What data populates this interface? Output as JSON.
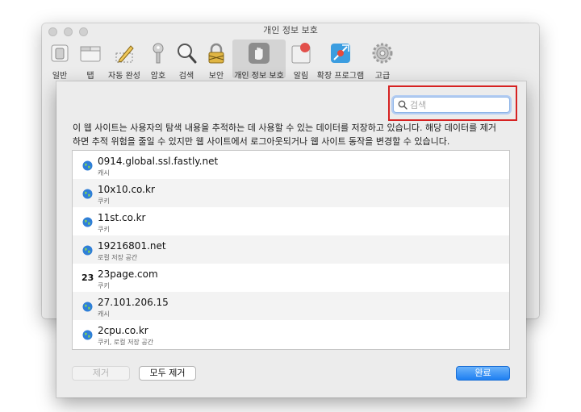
{
  "window": {
    "title": "개인 정보 보호"
  },
  "toolbar": {
    "tabs": [
      {
        "label": "일반",
        "icon": "general-switch-icon"
      },
      {
        "label": "탭",
        "icon": "tabs-icon"
      },
      {
        "label": "자동 완성",
        "icon": "autofill-pencil-icon"
      },
      {
        "label": "암호",
        "icon": "key-icon"
      },
      {
        "label": "검색",
        "icon": "magnifier-icon"
      },
      {
        "label": "보안",
        "icon": "lock-icon"
      },
      {
        "label": "개인 정보 보호",
        "icon": "hand-icon",
        "selected": true
      },
      {
        "label": "알림",
        "icon": "notifications-icon"
      },
      {
        "label": "확장 프로그램",
        "icon": "extensions-icon"
      },
      {
        "label": "고급",
        "icon": "gear-icon"
      }
    ]
  },
  "sheet": {
    "search_placeholder": "검색",
    "description_line1": "이 웹 사이트는 사용자의 탐색 내용을 추적하는 데 사용할 수 있는 데이터를 저장하고 있습니다. 해당 데이터를 제거",
    "description_line2": "하면 추적 위험을 줄일 수 있지만 웹 사이트에서 로그아웃되거나 웹 사이트 동작을 변경할 수 있습니다.",
    "sites": [
      {
        "name": "0914.global.ssl.fastly.net",
        "kind": "캐시",
        "icon": "globe-icon"
      },
      {
        "name": "10x10.co.kr",
        "kind": "쿠키",
        "icon": "globe-icon"
      },
      {
        "name": "11st.co.kr",
        "kind": "쿠키",
        "icon": "globe-icon"
      },
      {
        "name": "19216801.net",
        "kind": "로컬 저장 공간",
        "icon": "globe-icon"
      },
      {
        "name": "23page.com",
        "kind": "쿠키",
        "icon": "site-favicon",
        "favicon_text": "23"
      },
      {
        "name": "27.101.206.15",
        "kind": "캐시",
        "icon": "globe-icon"
      },
      {
        "name": "2cpu.co.kr",
        "kind": "쿠키, 로컬 저장 공간",
        "icon": "globe-icon"
      }
    ],
    "buttons": {
      "remove": "제거",
      "remove_all": "모두 제거",
      "done": "완료"
    }
  },
  "colors": {
    "highlight": "#d62222",
    "done_button": "#1e7ff2"
  }
}
